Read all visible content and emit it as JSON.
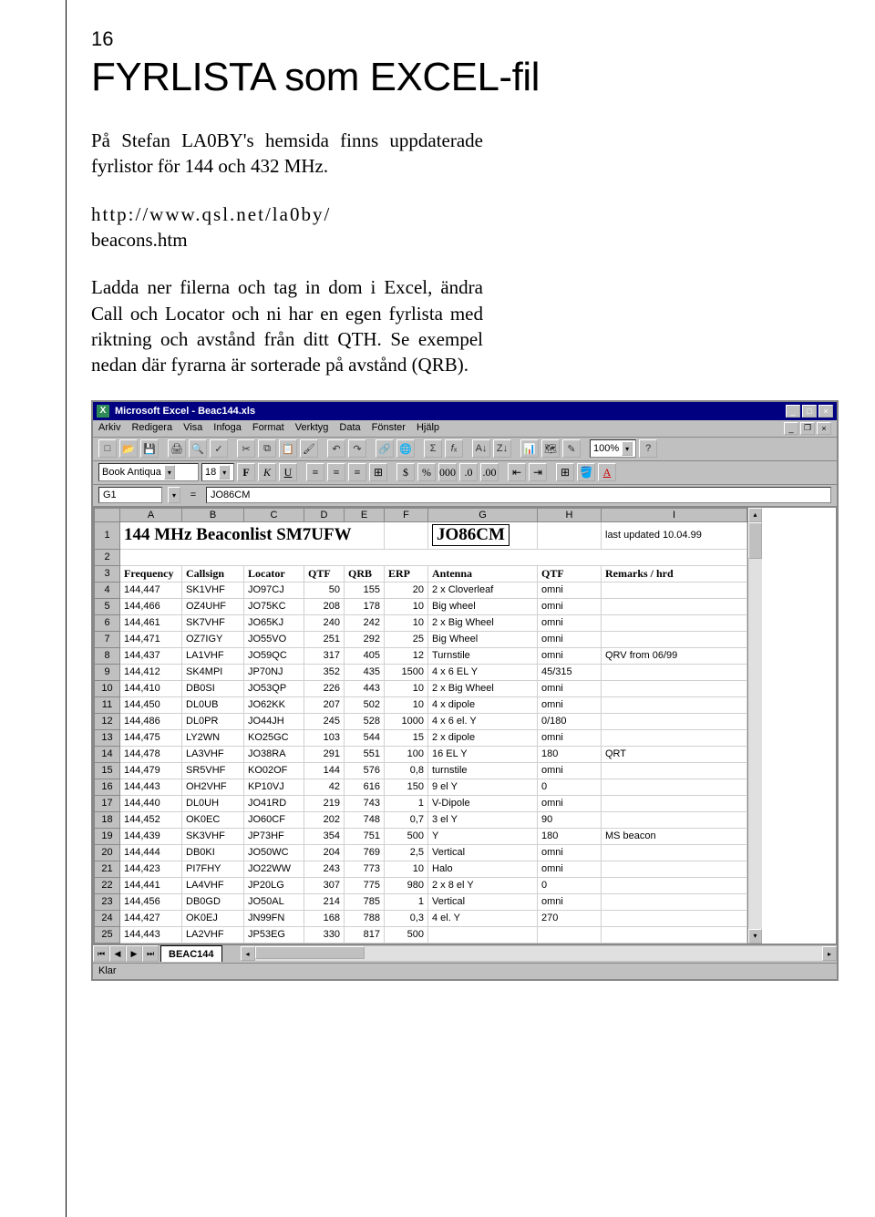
{
  "page_number": "16",
  "title": "FYRLISTA som EXCEL-fil",
  "para1": "På Stefan LA0BY's hemsida finns uppdaterade fyrlistor för 144 och 432 MHz.",
  "url_line1": "http://www.qsl.net/la0by/",
  "url_line2": "beacons.htm",
  "para2": "Ladda ner filerna och tag in dom i Excel, ändra Call och Locator och ni har en egen fyrlista med riktning och avstånd från ditt QTH. Se exempel nedan där fyrarna är sorterade på avstånd (QRB).",
  "excel": {
    "window_title": "Microsoft Excel - Beac144.xls",
    "menus": [
      "Arkiv",
      "Redigera",
      "Visa",
      "Infoga",
      "Format",
      "Verktyg",
      "Data",
      "Fönster",
      "Hjälp"
    ],
    "zoom": "100%",
    "font_name": "Book Antiqua",
    "font_size": "18",
    "namebox": "G1",
    "formula_value": "JO86CM",
    "columns": [
      "A",
      "B",
      "C",
      "D",
      "E",
      "F",
      "G",
      "H",
      "I"
    ],
    "beacon_title": "144 MHz Beaconlist   SM7UFW",
    "beacon_locator": "JO86CM",
    "last_updated": "last updated 10.04.99",
    "headers": [
      "Frequency",
      "Callsign",
      "Locator",
      "QTF",
      "QRB",
      "ERP",
      "Antenna",
      "QTF",
      "Remarks / hrd"
    ],
    "rows": [
      {
        "n": "4",
        "f": "144,447",
        "c": "SK1VHF",
        "l": "JO97CJ",
        "qtf": "50",
        "qrb": "155",
        "erp": "20",
        "ant": "2 x Cloverleaf",
        "q2": "omni",
        "r": ""
      },
      {
        "n": "5",
        "f": "144,466",
        "c": "OZ4UHF",
        "l": "JO75KC",
        "qtf": "208",
        "qrb": "178",
        "erp": "10",
        "ant": "Big wheel",
        "q2": "omni",
        "r": ""
      },
      {
        "n": "6",
        "f": "144,461",
        "c": "SK7VHF",
        "l": "JO65KJ",
        "qtf": "240",
        "qrb": "242",
        "erp": "10",
        "ant": "2 x Big Wheel",
        "q2": "omni",
        "r": ""
      },
      {
        "n": "7",
        "f": "144,471",
        "c": "OZ7IGY",
        "l": "JO55VO",
        "qtf": "251",
        "qrb": "292",
        "erp": "25",
        "ant": "Big Wheel",
        "q2": "omni",
        "r": ""
      },
      {
        "n": "8",
        "f": "144,437",
        "c": "LA1VHF",
        "l": "JO59QC",
        "qtf": "317",
        "qrb": "405",
        "erp": "12",
        "ant": "Turnstile",
        "q2": "omni",
        "r": "QRV from 06/99"
      },
      {
        "n": "9",
        "f": "144,412",
        "c": "SK4MPI",
        "l": "JP70NJ",
        "qtf": "352",
        "qrb": "435",
        "erp": "1500",
        "ant": "4 x 6 EL Y",
        "q2": "45/315",
        "r": ""
      },
      {
        "n": "10",
        "f": "144,410",
        "c": "DB0SI",
        "l": "JO53QP",
        "qtf": "226",
        "qrb": "443",
        "erp": "10",
        "ant": "2 x Big Wheel",
        "q2": "omni",
        "r": ""
      },
      {
        "n": "11",
        "f": "144,450",
        "c": "DL0UB",
        "l": "JO62KK",
        "qtf": "207",
        "qrb": "502",
        "erp": "10",
        "ant": "4 x dipole",
        "q2": "omni",
        "r": ""
      },
      {
        "n": "12",
        "f": "144,486",
        "c": "DL0PR",
        "l": "JO44JH",
        "qtf": "245",
        "qrb": "528",
        "erp": "1000",
        "ant": "4 x 6 el. Y",
        "q2": "0/180",
        "r": ""
      },
      {
        "n": "13",
        "f": "144,475",
        "c": "LY2WN",
        "l": "KO25GC",
        "qtf": "103",
        "qrb": "544",
        "erp": "15",
        "ant": "2 x dipole",
        "q2": "omni",
        "r": ""
      },
      {
        "n": "14",
        "f": "144,478",
        "c": "LA3VHF",
        "l": "JO38RA",
        "qtf": "291",
        "qrb": "551",
        "erp": "100",
        "ant": "16 EL Y",
        "q2": "180",
        "r": "QRT"
      },
      {
        "n": "15",
        "f": "144,479",
        "c": "SR5VHF",
        "l": "KO02OF",
        "qtf": "144",
        "qrb": "576",
        "erp": "0,8",
        "ant": "turnstile",
        "q2": "omni",
        "r": ""
      },
      {
        "n": "16",
        "f": "144,443",
        "c": "OH2VHF",
        "l": "KP10VJ",
        "qtf": "42",
        "qrb": "616",
        "erp": "150",
        "ant": "9 el Y",
        "q2": "0",
        "r": ""
      },
      {
        "n": "17",
        "f": "144,440",
        "c": "DL0UH",
        "l": "JO41RD",
        "qtf": "219",
        "qrb": "743",
        "erp": "1",
        "ant": "V-Dipole",
        "q2": "omni",
        "r": ""
      },
      {
        "n": "18",
        "f": "144,452",
        "c": "OK0EC",
        "l": "JO60CF",
        "qtf": "202",
        "qrb": "748",
        "erp": "0,7",
        "ant": "3 el Y",
        "q2": "90",
        "r": ""
      },
      {
        "n": "19",
        "f": "144,439",
        "c": "SK3VHF",
        "l": "JP73HF",
        "qtf": "354",
        "qrb": "751",
        "erp": "500",
        "ant": "Y",
        "q2": "180",
        "r": "MS beacon"
      },
      {
        "n": "20",
        "f": "144,444",
        "c": "DB0KI",
        "l": "JO50WC",
        "qtf": "204",
        "qrb": "769",
        "erp": "2,5",
        "ant": "Vertical",
        "q2": "omni",
        "r": ""
      },
      {
        "n": "21",
        "f": "144,423",
        "c": "PI7FHY",
        "l": "JO22WW",
        "qtf": "243",
        "qrb": "773",
        "erp": "10",
        "ant": "Halo",
        "q2": "omni",
        "r": ""
      },
      {
        "n": "22",
        "f": "144,441",
        "c": "LA4VHF",
        "l": "JP20LG",
        "qtf": "307",
        "qrb": "775",
        "erp": "980",
        "ant": "2 x 8 el Y",
        "q2": "0",
        "r": ""
      },
      {
        "n": "23",
        "f": "144,456",
        "c": "DB0GD",
        "l": "JO50AL",
        "qtf": "214",
        "qrb": "785",
        "erp": "1",
        "ant": "Vertical",
        "q2": "omni",
        "r": ""
      },
      {
        "n": "24",
        "f": "144,427",
        "c": "OK0EJ",
        "l": "JN99FN",
        "qtf": "168",
        "qrb": "788",
        "erp": "0,3",
        "ant": "4 el. Y",
        "q2": "270",
        "r": ""
      }
    ],
    "partial_row": {
      "n": "25",
      "f": "144,443",
      "c": "LA2VHF",
      "l": "JP53EG",
      "qtf": "330",
      "qrb": "817",
      "erp": "500",
      "ant": "",
      "q2": "",
      "r": ""
    },
    "sheet_tab": "BEAC144",
    "status": "Klar"
  }
}
